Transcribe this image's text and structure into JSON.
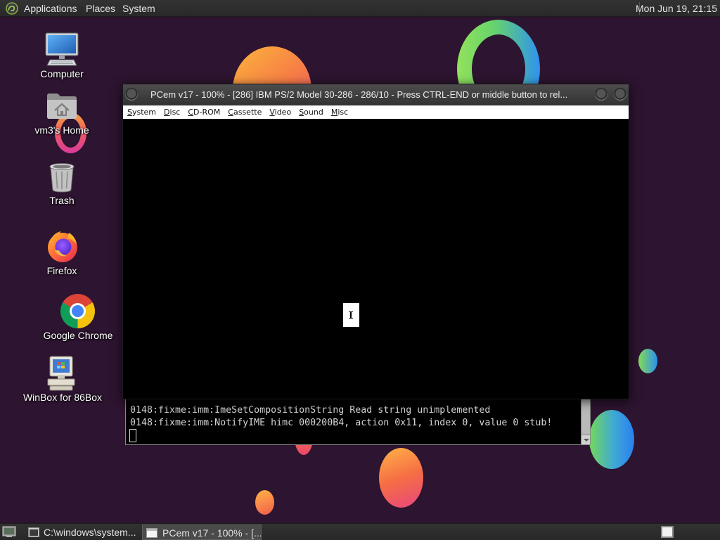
{
  "top_panel": {
    "menus": [
      "Applications",
      "Places",
      "System"
    ],
    "clock": "Mon Jun 19, 21:15",
    "logo_icon": "mate-logo-icon"
  },
  "desktop_icons": [
    {
      "label": "Computer",
      "icon": "computer-icon"
    },
    {
      "label": "vm3's Home",
      "icon": "home-folder-icon"
    },
    {
      "label": "Trash",
      "icon": "trash-icon"
    },
    {
      "label": "Firefox",
      "icon": "firefox-icon"
    },
    {
      "label": "Google Chrome",
      "icon": "chrome-icon"
    },
    {
      "label": "WinBox for 86Box",
      "icon": "winbox-icon"
    }
  ],
  "pcem_window": {
    "title": "PCem v17 - 100% - [286] IBM PS/2 Model 30-286 - 286/10 - Press CTRL-END or middle button to rel...",
    "menu": [
      "System",
      "Disc",
      "CD-ROM",
      "Cassette",
      "Video",
      "Sound",
      "Misc"
    ]
  },
  "terminal": {
    "lines": [
      "0148:fixme:imm:ImeSetCompositionString Read string unimplemented",
      "0148:fixme:imm:NotifyIME himc 000200B4, action 0x11, index 0, value 0 stub!"
    ]
  },
  "taskbar": {
    "tasks": [
      {
        "label": "C:\\windows\\system...",
        "icon": "console-window-icon",
        "active": false
      },
      {
        "label": "PCem v17 - 100% - [...",
        "icon": "window-icon",
        "active": true
      }
    ],
    "show_desktop_icon": "show-desktop-icon",
    "workspace_icon": "workspace-switcher-icon"
  },
  "colors": {
    "desktop_background": "#2d1430",
    "panel_background": "#2e2e2e",
    "emulator_screen": "#000000",
    "menu_bar": "#ffffff"
  }
}
